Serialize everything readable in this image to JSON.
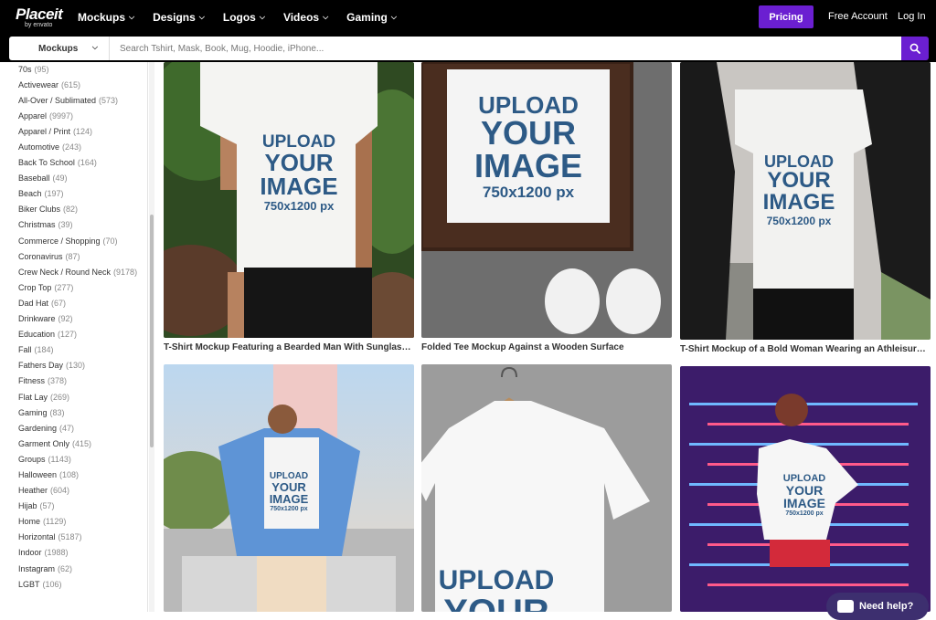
{
  "brand": {
    "name": "Placeit",
    "sub": "by envato"
  },
  "nav": [
    {
      "label": "Mockups"
    },
    {
      "label": "Designs"
    },
    {
      "label": "Logos"
    },
    {
      "label": "Videos"
    },
    {
      "label": "Gaming"
    }
  ],
  "header": {
    "pricing": "Pricing",
    "free_account": "Free Account",
    "login": "Log In"
  },
  "search": {
    "category": "Mockups",
    "placeholder": "Search Tshirt, Mask, Book, Mug, Hoodie, iPhone..."
  },
  "sidebar": {
    "categories": [
      {
        "name": "70s",
        "count": "(95)"
      },
      {
        "name": "Activewear",
        "count": "(615)"
      },
      {
        "name": "All-Over / Sublimated",
        "count": "(573)"
      },
      {
        "name": "Apparel",
        "count": "(9997)"
      },
      {
        "name": "Apparel / Print",
        "count": "(124)"
      },
      {
        "name": "Automotive",
        "count": "(243)"
      },
      {
        "name": "Back To School",
        "count": "(164)"
      },
      {
        "name": "Baseball",
        "count": "(49)"
      },
      {
        "name": "Beach",
        "count": "(197)"
      },
      {
        "name": "Biker Clubs",
        "count": "(82)"
      },
      {
        "name": "Christmas",
        "count": "(39)"
      },
      {
        "name": "Commerce / Shopping",
        "count": "(70)"
      },
      {
        "name": "Coronavirus",
        "count": "(87)"
      },
      {
        "name": "Crew Neck / Round Neck",
        "count": "(9178)"
      },
      {
        "name": "Crop Top",
        "count": "(277)"
      },
      {
        "name": "Dad Hat",
        "count": "(67)"
      },
      {
        "name": "Drinkware",
        "count": "(92)"
      },
      {
        "name": "Education",
        "count": "(127)"
      },
      {
        "name": "Fall",
        "count": "(184)"
      },
      {
        "name": "Fathers Day",
        "count": "(130)"
      },
      {
        "name": "Fitness",
        "count": "(378)"
      },
      {
        "name": "Flat Lay",
        "count": "(269)"
      },
      {
        "name": "Gaming",
        "count": "(83)"
      },
      {
        "name": "Gardening",
        "count": "(47)"
      },
      {
        "name": "Garment Only",
        "count": "(415)"
      },
      {
        "name": "Groups",
        "count": "(1143)"
      },
      {
        "name": "Halloween",
        "count": "(108)"
      },
      {
        "name": "Heather",
        "count": "(604)"
      },
      {
        "name": "Hijab",
        "count": "(57)"
      },
      {
        "name": "Home",
        "count": "(1129)"
      },
      {
        "name": "Horizontal",
        "count": "(5187)"
      },
      {
        "name": "Indoor",
        "count": "(1988)"
      },
      {
        "name": "Instagram",
        "count": "(62)"
      },
      {
        "name": "LGBT",
        "count": "(106)"
      }
    ]
  },
  "upload": {
    "line1": "UPLOAD",
    "line2": "YOUR",
    "line3": "IMAGE",
    "line4": "750x1200 px"
  },
  "cards": [
    {
      "caption": "T-Shirt Mockup Featuring a Bearded Man With Sunglasses..."
    },
    {
      "caption": "Folded Tee Mockup Against a Wooden Surface"
    },
    {
      "caption": "T-Shirt Mockup of a Bold Woman Wearing an Athleisure Outfit"
    },
    {
      "caption": ""
    },
    {
      "caption": ""
    },
    {
      "caption": ""
    }
  ],
  "help": {
    "label": "Need help?"
  },
  "colors": {
    "accent": "#6b1fd1",
    "upload_text": "#2d5a86"
  }
}
